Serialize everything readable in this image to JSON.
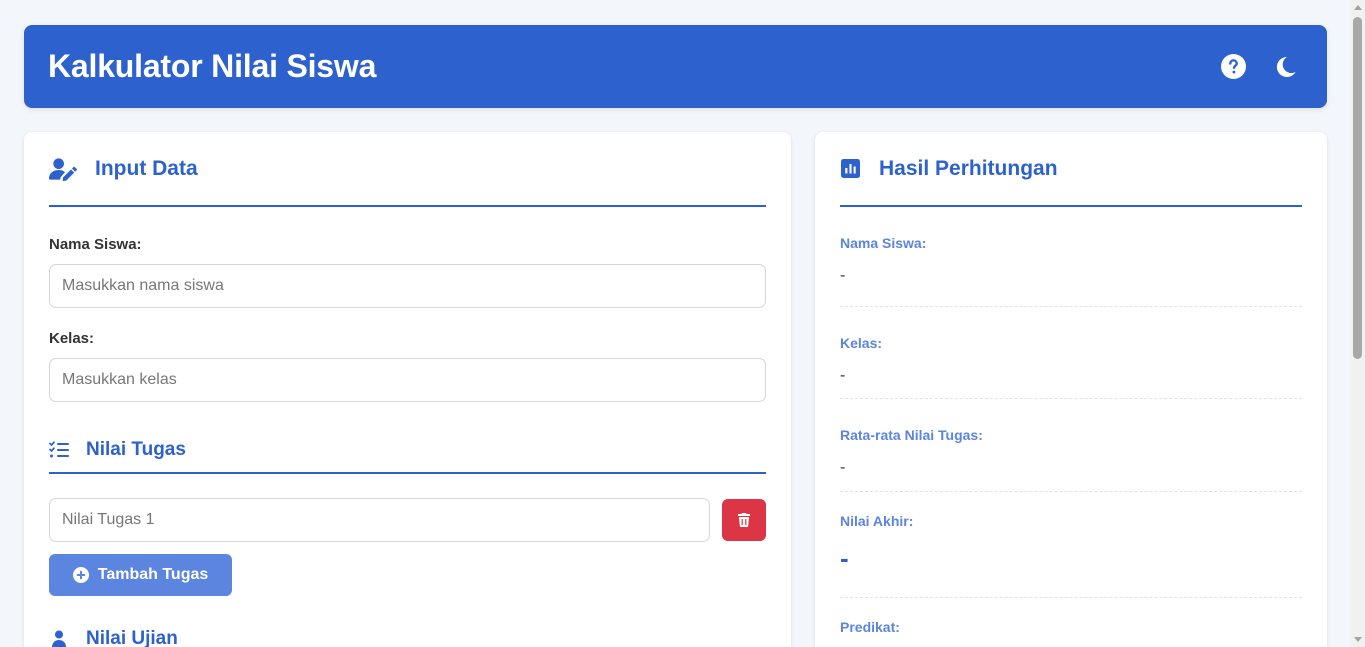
{
  "app": {
    "title": "Kalkulator Nilai Siswa",
    "accent_color": "#2d62ce",
    "header_icons": [
      "help-circle-icon",
      "moon-icon"
    ]
  },
  "input": {
    "title": "Input Data",
    "title_icon": "user-edit-icon",
    "name_label": "Nama Siswa:",
    "name_placeholder": "Masukkan nama siswa",
    "name_value": "",
    "class_label": "Kelas:",
    "class_placeholder": "Masukkan kelas",
    "class_value": ""
  },
  "tasks": {
    "title": "Nilai Tugas",
    "title_icon": "list-check-icon",
    "items": [
      {
        "placeholder": "Nilai Tugas 1",
        "value": ""
      }
    ],
    "delete_icon": "trash-icon",
    "add_label": "Tambah Tugas",
    "add_icon": "plus-circle-icon"
  },
  "next_section": {
    "title": "Nilai Ujian",
    "icon": "user-icon"
  },
  "results": {
    "title": "Hasil Perhitungan",
    "title_icon": "chart-bar-icon",
    "items": [
      {
        "label": "Nama Siswa:",
        "value": "-"
      },
      {
        "label": "Kelas:",
        "value": "-"
      },
      {
        "label": "Rata-rata Nilai Tugas:",
        "value": "-"
      },
      {
        "label": "Nilai Akhir:",
        "value": "-"
      },
      {
        "label": "Predikat:",
        "value": ""
      }
    ]
  }
}
